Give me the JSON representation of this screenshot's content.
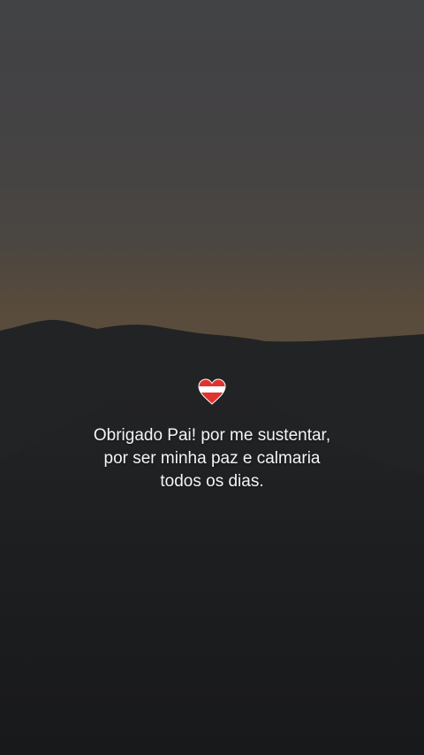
{
  "story": {
    "caption_lines": [
      "Obrigado Pai! por me sustentar,",
      "por ser minha paz e calmaria",
      "todos os dias."
    ],
    "sticker_icon": "red-white-heart-icon",
    "colors": {
      "sky_top": "#414345",
      "sky_horizon": "#5a4c3c",
      "mountain": "#1f2022",
      "foreground": "#18191a",
      "heart_red": "#e0322f",
      "heart_white": "#ffffff",
      "caption_text": "#f4f4f4"
    }
  }
}
